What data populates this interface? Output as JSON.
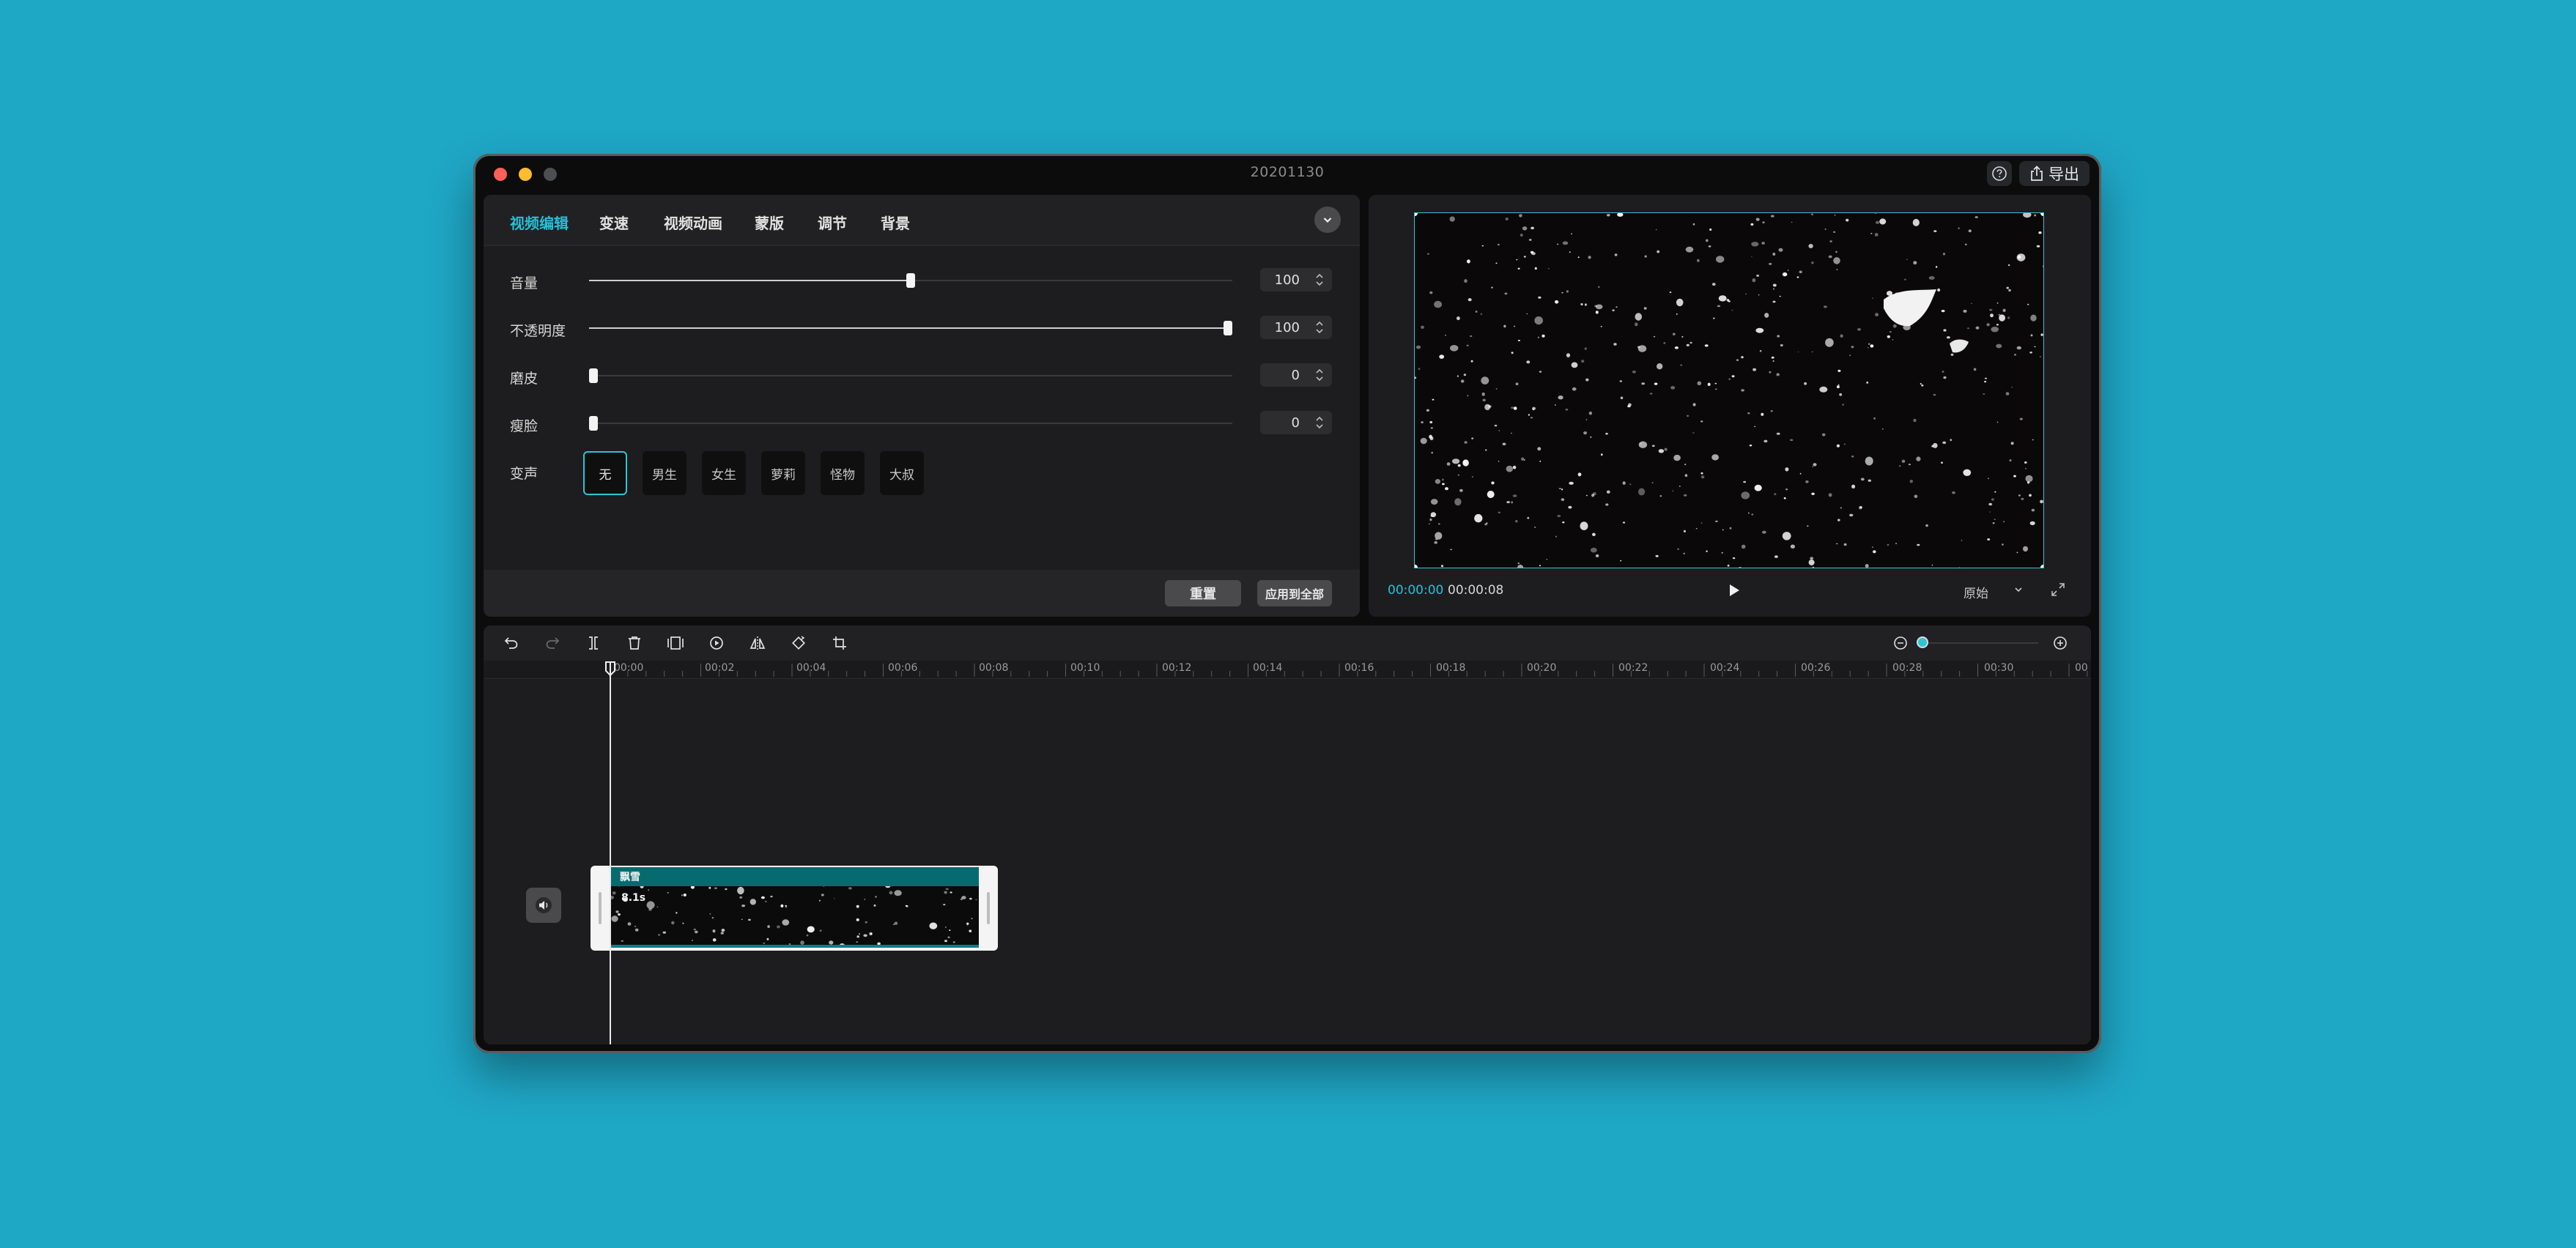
{
  "window": {
    "title": "20201130",
    "export_label": "导出"
  },
  "tabs": [
    "视频编辑",
    "变速",
    "视频动画",
    "蒙版",
    "调节",
    "背景"
  ],
  "params": {
    "volume": {
      "label": "音量",
      "value": "100",
      "fraction": 0.5
    },
    "opacity": {
      "label": "不透明度",
      "value": "100",
      "fraction": 1.0
    },
    "smooth": {
      "label": "磨皮",
      "value": "0",
      "fraction": 0.0
    },
    "slim": {
      "label": "瘦脸",
      "value": "0",
      "fraction": 0.0
    }
  },
  "voice": {
    "label": "变声",
    "options": [
      "无",
      "男生",
      "女生",
      "萝莉",
      "怪物",
      "大叔"
    ],
    "selected": "无"
  },
  "footer": {
    "reset_label": "重置",
    "apply_label": "应用到全部"
  },
  "preview": {
    "current_time": "00:00:00",
    "total_time": "00:00:08",
    "ratio": "原始"
  },
  "timeline": {
    "ruler": [
      "00:00",
      "00:02",
      "00:04",
      "00:06",
      "00:08",
      "00:10",
      "00:12",
      "00:14",
      "00:16",
      "00:18",
      "00:20",
      "00:22",
      "00:24",
      "00:26",
      "00:28",
      "00:30",
      "00"
    ],
    "clip": {
      "name": "飘雪",
      "duration": "8.1s"
    }
  },
  "colors": {
    "accent": "#23c2d6",
    "background": "#1fa7c6",
    "panel": "#1d1d1f"
  }
}
